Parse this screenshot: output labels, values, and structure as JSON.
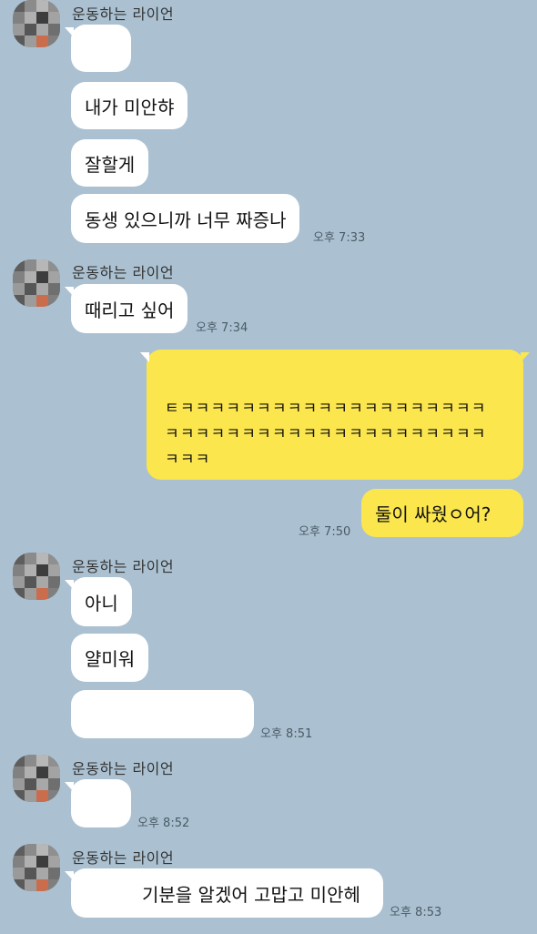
{
  "chat": {
    "sender_name": "운동하는 라이언",
    "colors": {
      "background": "#abc1d1",
      "incoming_bubble": "#ffffff",
      "outgoing_bubble": "#fbe64d"
    },
    "groups": [
      {
        "messages": [
          "",
          "내가 미안햐",
          "잘할게",
          "동생 있으니까 너무 짜증나"
        ],
        "time": "오후 7:33"
      },
      {
        "messages": [
          "때리고 싶어"
        ],
        "time": "오후 7:34"
      },
      {
        "messages": [
          "ㅌㅋㅋㅋㅋㅋㅋㅋㅋㅋㅋㅋㅋㅋㅋㅋㅋㅋㅋㅋㅋㅋㅋㅋㅋㅋㅋㅋㅋㅋㅋㅋㅋㅋㅋㅋㅋㅋㅋㅋㅋㅋㅋㅋㅋ"
        ],
        "time": ""
      },
      {
        "messages": [
          "둘이 싸웠ㅇ어?"
        ],
        "time": "오후 7:50"
      },
      {
        "messages": [
          "아니",
          "얄미워",
          ""
        ],
        "time": "오후 8:51"
      },
      {
        "messages": [
          ""
        ],
        "time": "오후 8:52"
      },
      {
        "messages": [
          "기분을 알겠어 고맙고 미안헤"
        ],
        "time": "오후 8:53"
      }
    ]
  }
}
